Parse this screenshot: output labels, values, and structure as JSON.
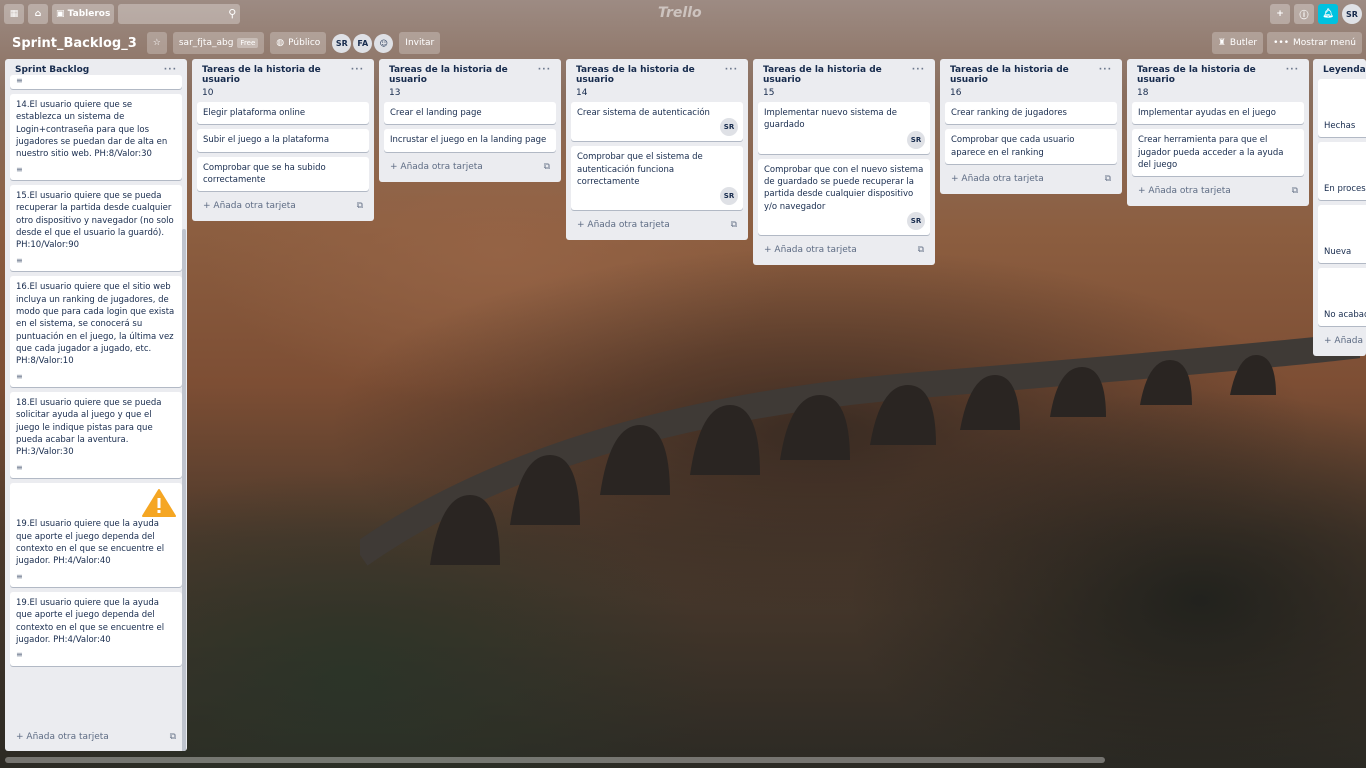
{
  "topbar": {
    "boards_label": "Tableros",
    "logo": "Trello",
    "user_initials": "SR"
  },
  "board": {
    "title": "Sprint_Backlog_3",
    "team": "sar_fjta_abg",
    "team_badge": "Free",
    "visibility": "Público",
    "members": [
      "SR",
      "FA"
    ],
    "invite_label": "Invitar",
    "butler_label": "Butler",
    "menu_label": "Mostrar menú"
  },
  "add_card_label": "Añada otra tarjeta",
  "lists": [
    {
      "title": "Sprint Backlog",
      "cards": [
        {
          "text": "14.El usuario quiere que se establezca un sistema de Login+contraseña para que los jugadores se puedan dar de alta en nuestro sitio web. PH:8/Valor:30"
        },
        {
          "text": "15.El usuario quiere que se pueda recuperar la partida desde cualquier otro dispositivo y navegador (no solo desde el que el usuario la guardó). PH:10/Valor:90"
        },
        {
          "text": "16.El usuario quiere que el sitio web incluya un ranking de jugadores, de modo que para cada login que exista en el sistema, se conocerá su puntuación en el juego, la última vez que cada jugador a jugado, etc. PH:8/Valor:10"
        },
        {
          "text": "18.El usuario quiere que se pueda solicitar ayuda al juego y que el juego le indique pistas para que pueda acabar la aventura. PH:3/Valor:30"
        },
        {
          "text": "19.El usuario quiere que la ayuda que aporte el juego dependa del contexto en el que se encuentre el jugador. PH:4/Valor:40"
        },
        {
          "text": "19.El usuario quiere que la ayuda que aporte el juego dependa del contexto en el que se encuentre el jugador. PH:4/Valor:40"
        }
      ]
    },
    {
      "title": "Tareas de la historia de usuario",
      "number": "10",
      "cards": [
        {
          "text": "Elegir plataforma online"
        },
        {
          "text": "Subir el juego a la plataforma"
        },
        {
          "text": "Comprobar que se ha subido correctamente"
        }
      ]
    },
    {
      "title": "Tareas de la historia de usuario",
      "number": "13",
      "cards": [
        {
          "text": "Crear el landing page"
        },
        {
          "text": "Incrustar el juego en la landing page"
        }
      ]
    },
    {
      "title": "Tareas de la historia de usuario",
      "number": "14",
      "cards": [
        {
          "text": "Crear sistema de autenticación",
          "member": "SR"
        },
        {
          "text": "Comprobar que el sistema de autenticación funciona correctamente",
          "member": "SR"
        }
      ]
    },
    {
      "title": "Tareas de la historia de usuario",
      "number": "15",
      "cards": [
        {
          "text": "Implementar nuevo sistema de guardado",
          "member": "SR"
        },
        {
          "text": "Comprobar que con el nuevo sistema de guardado se puede recuperar la partida desde cualquier dispositivo y/o navegador",
          "member": "SR"
        }
      ]
    },
    {
      "title": "Tareas de la historia de usuario",
      "number": "16",
      "cards": [
        {
          "text": "Crear ranking de jugadores"
        },
        {
          "text": "Comprobar que cada usuario aparece en el ranking"
        }
      ]
    },
    {
      "title": "Tareas de la historia de usuario",
      "number": "18",
      "cards": [
        {
          "text": "Implementar ayudas en el juego"
        },
        {
          "text": "Crear herramienta para que el jugador pueda acceder a la ayuda del juego"
        }
      ]
    },
    {
      "title": "Leyenda",
      "cards": [
        {
          "text": "Hechas"
        },
        {
          "text": "En proceso"
        },
        {
          "text": "Nueva"
        },
        {
          "text": "No acabadas"
        }
      ],
      "add_label": "Añada"
    }
  ]
}
